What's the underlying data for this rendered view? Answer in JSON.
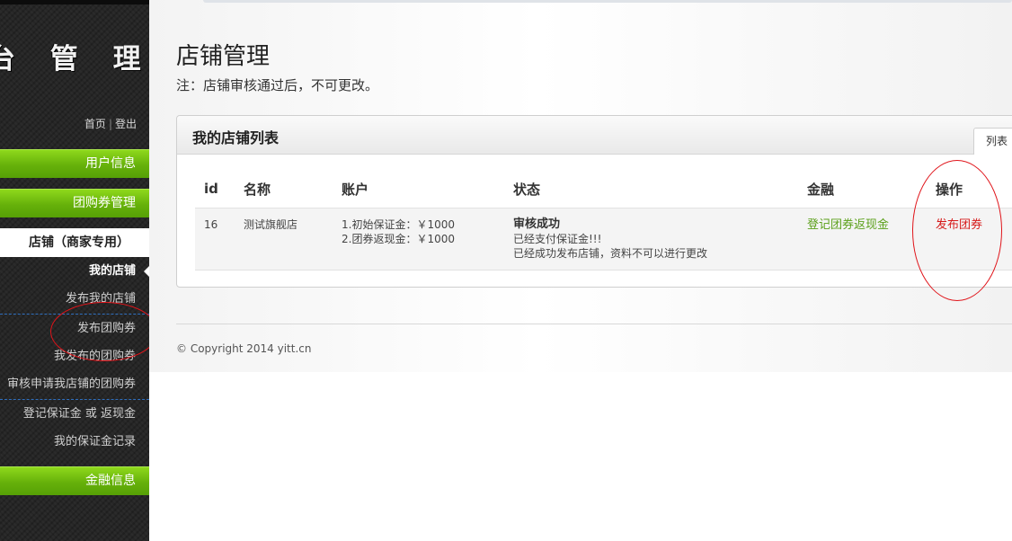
{
  "sidebar": {
    "logo": "台 管 理",
    "top_links": {
      "home": "首页",
      "sep": "|",
      "logout": "登出"
    },
    "sections": {
      "user_info": "用户信息",
      "coupon_mgmt": "团购券管理",
      "store": "店铺（商家专用）",
      "finance": "金融信息"
    },
    "store_items": [
      "我的店铺",
      "发布我的店铺",
      "发布团购券",
      "我发布的团购券",
      "审核申请我店铺的团购券",
      "登记保证金 或 返现金",
      "我的保证金记录"
    ]
  },
  "main": {
    "title": "店铺管理",
    "note": "注：店铺审核通过后，不可更改。",
    "panel": {
      "title": "我的店铺列表",
      "tab": "列表",
      "columns": [
        "id",
        "名称",
        "账户",
        "状态",
        "金融",
        "操作"
      ],
      "rows": [
        {
          "id": "16",
          "name": "测试旗舰店",
          "account_line1": "1.初始保证金：￥1000",
          "account_line2": "2.团券返现金：￥1000",
          "status_title": "审核成功",
          "status_line1": "已经支付保证金!!!",
          "status_line2": "已经成功发布店铺，资料不可以进行更改",
          "finance_link": "登记团券返现金",
          "action_link": "发布团券"
        }
      ]
    },
    "copyright": "© Copyright 2014 yitt.cn"
  },
  "colors": {
    "sidebar_bg": "#262626",
    "green_accent": "#66b10a",
    "finance_link": "#5ba01a",
    "action_link": "#d61a1a",
    "annotation": "#e0141a"
  }
}
